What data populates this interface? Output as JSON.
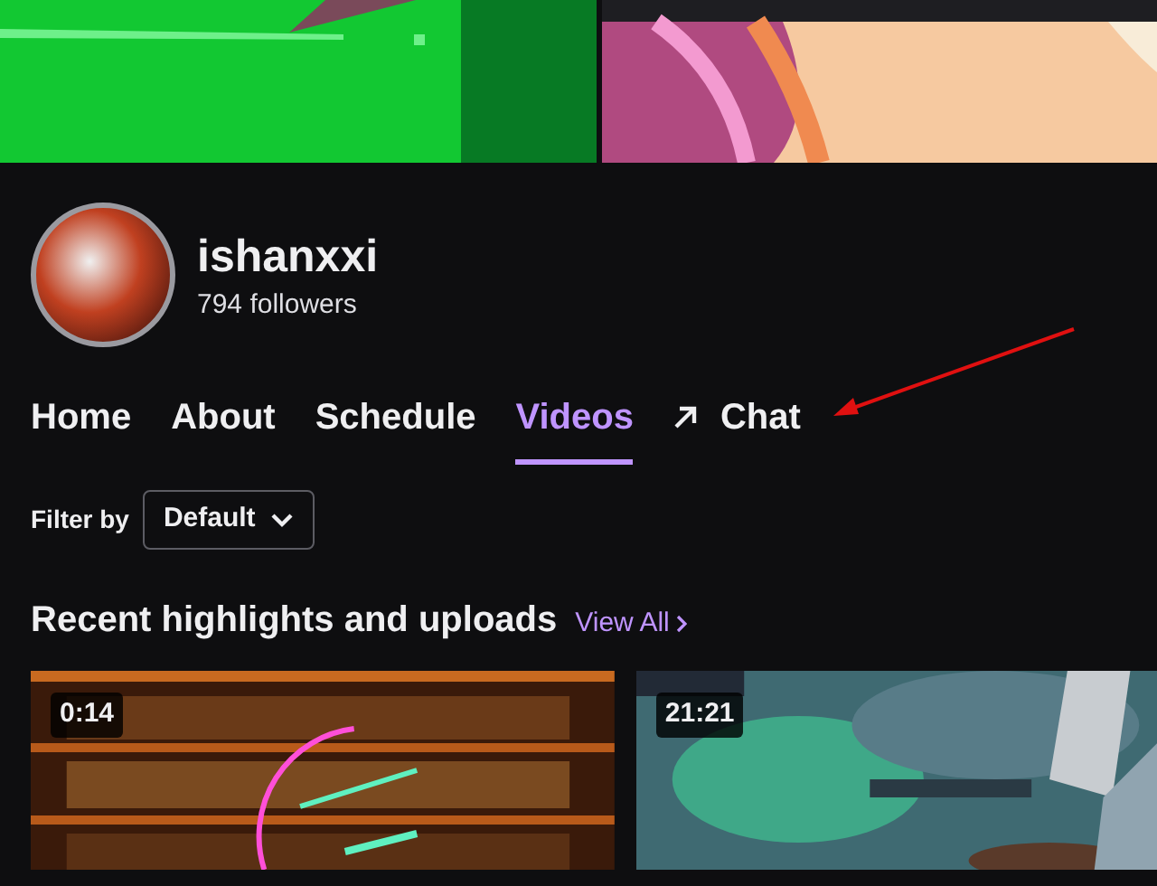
{
  "channel": {
    "name": "ishanxxi",
    "followers": "794 followers"
  },
  "tabs": [
    {
      "label": "Home",
      "selected": false,
      "kind": "tab"
    },
    {
      "label": "About",
      "selected": false,
      "kind": "tab"
    },
    {
      "label": "Schedule",
      "selected": false,
      "kind": "tab"
    },
    {
      "label": "Videos",
      "selected": true,
      "kind": "tab"
    },
    {
      "label": "Chat",
      "selected": false,
      "kind": "external"
    }
  ],
  "filter": {
    "label": "Filter by",
    "value": "Default"
  },
  "section": {
    "title": "Recent highlights and uploads",
    "link": "View All"
  },
  "videos": [
    {
      "duration": "0:14",
      "kind": "bar"
    },
    {
      "duration": "21:21",
      "kind": "game"
    }
  ]
}
